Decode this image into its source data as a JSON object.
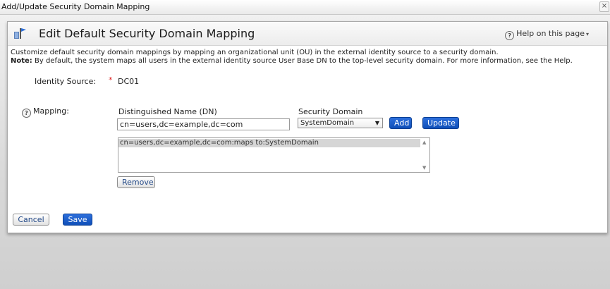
{
  "window": {
    "title": "Add/Update Security Domain Mapping",
    "close_glyph": "×"
  },
  "header": {
    "icon": "security-domain-icon",
    "title": "Edit Default Security Domain Mapping",
    "help_label": "Help on this page",
    "help_caret": "▾"
  },
  "description": {
    "line1": "Customize default security domain mappings by mapping an organizational unit (OU) in the external identity source to a security domain.",
    "note_label": "Note:",
    "note_text": " By default, the system maps all users in the external identity source User Base DN to the top-level security domain. For more information, see the Help."
  },
  "identity_source": {
    "label": "Identity Source:",
    "required_marker": "*",
    "value": "DC01"
  },
  "mapping": {
    "label": "Mapping:",
    "dn_header": "Distinguished Name (DN)",
    "dn_value": "cn=users,dc=example,dc=com",
    "domain_header": "Security Domain",
    "domain_selected": "SystemDomain",
    "add_label": "Add",
    "update_label": "Update",
    "entries": [
      "cn=users,dc=example,dc=com:maps to:SystemDomain"
    ],
    "remove_label": "Remove"
  },
  "footer": {
    "cancel_label": "Cancel",
    "save_label": "Save"
  },
  "colors": {
    "accent": "#1a5bc8",
    "required": "#dd2222"
  }
}
